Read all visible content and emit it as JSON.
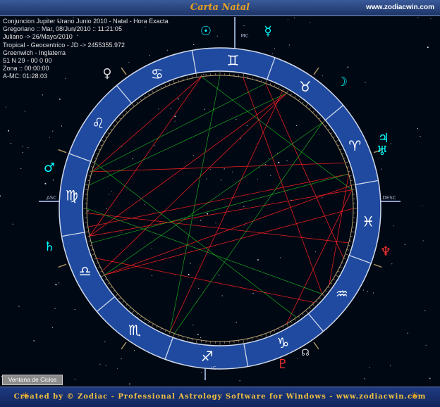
{
  "window": {
    "title": "Carta Natal",
    "url": "www.zodiacwin.com"
  },
  "info_lines": [
    "Conjuncion Jupiter Urano Junio 2010 - Natal - Hora Exacta",
    "Gregoriano :: Mar, 08/Jun/2010 :: 11:21:05",
    "Juliano -> 26/Mayo/2010",
    "Tropical - Geocentrico - JD -> 2455355.972",
    "Greenwich - Inglaterra",
    "51 N 29 - 00 0 00",
    "Zona :: 00:00:00",
    "A-MC: 01:28:03"
  ],
  "ventana_button": "Ventana de Ciclos",
  "footer": "Created by © Zodiac - Professional Astrology Software for Windows - www.zodiacwin.com",
  "colors": {
    "ring": "#1f4aa0",
    "sign_glyph": "#ffffff",
    "planet": "#00ffff",
    "neptune": "#ff3333",
    "aspect_red": "#ff2020",
    "aspect_green": "#20c020",
    "axis": "#8aa0c8"
  },
  "zodiac_signs": [
    {
      "glyph": "♊",
      "name": "gemini-sign"
    },
    {
      "glyph": "♉",
      "name": "taurus-sign"
    },
    {
      "glyph": "♈",
      "name": "aries-sign"
    },
    {
      "glyph": "♓",
      "name": "pisces-sign"
    },
    {
      "glyph": "♒",
      "name": "aquarius-sign"
    },
    {
      "glyph": "♑",
      "name": "capricorn-sign"
    },
    {
      "glyph": "♐",
      "name": "sagittarius-sign"
    },
    {
      "glyph": "♏",
      "name": "scorpio-sign"
    },
    {
      "glyph": "♎",
      "name": "libra-sign"
    },
    {
      "glyph": "♍",
      "name": "virgo-sign"
    },
    {
      "glyph": "♌",
      "name": "leo-sign"
    },
    {
      "glyph": "♋",
      "name": "cancer-sign"
    }
  ],
  "planets": [
    {
      "glyph": "☉",
      "name": "sun-glyph"
    },
    {
      "glyph": "☿",
      "name": "mercury-glyph"
    },
    {
      "glyph": "☽",
      "name": "moon-glyph"
    },
    {
      "glyph": "♃",
      "name": "jupiter-glyph"
    },
    {
      "glyph": "♅",
      "name": "uranus-glyph"
    },
    {
      "glyph": "♆",
      "name": "neptune-glyph"
    },
    {
      "glyph": "♂",
      "name": "mars-glyph"
    },
    {
      "glyph": "♄",
      "name": "saturn-glyph"
    },
    {
      "glyph": "♀",
      "name": "venus-glyph"
    },
    {
      "glyph": "♇",
      "name": "pluto-glyph"
    },
    {
      "glyph": "☊",
      "name": "node-glyph"
    }
  ],
  "axis_labels": {
    "mc": "MC",
    "asc": "ASC",
    "ic": "IC",
    "desc": "DESC"
  }
}
